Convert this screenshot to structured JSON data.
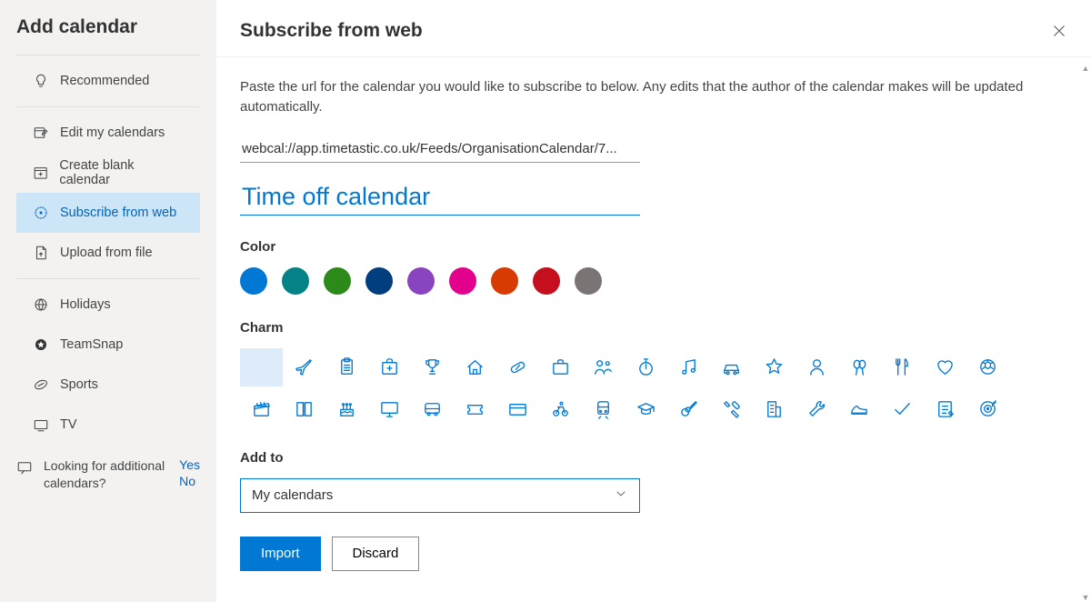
{
  "sidebar": {
    "title": "Add calendar",
    "items": [
      {
        "label": "Recommended",
        "icon": "lightbulb"
      },
      {
        "label": "Edit my calendars",
        "icon": "edit-cal"
      },
      {
        "label": "Create blank calendar",
        "icon": "add-cal"
      },
      {
        "label": "Subscribe from web",
        "icon": "web-cal",
        "active": true
      },
      {
        "label": "Upload from file",
        "icon": "upload"
      },
      {
        "label": "Holidays",
        "icon": "globe"
      },
      {
        "label": "TeamSnap",
        "icon": "teamsnap"
      },
      {
        "label": "Sports",
        "icon": "sports"
      },
      {
        "label": "TV",
        "icon": "tv"
      }
    ],
    "feedback": {
      "text": "Looking for additional calendars?",
      "yes": "Yes",
      "no": "No"
    }
  },
  "main": {
    "title": "Subscribe from web",
    "instructions": "Paste the url for the calendar you would like to subscribe to below. Any edits that the author of the calendar makes will be updated automatically.",
    "url_value": "webcal://app.timetastic.co.uk/Feeds/OrganisationCalendar/7...",
    "name_value": "Time off calendar",
    "labels": {
      "color": "Color",
      "charm": "Charm",
      "addto": "Add to"
    },
    "colors": [
      "#0078d4",
      "#038387",
      "#2b8a1a",
      "#003e7e",
      "#8845bf",
      "#e3008c",
      "#d83b01",
      "#c50f1f",
      "#7a7574"
    ],
    "charms_row1": [
      "none",
      "airplane",
      "clipboard",
      "first-aid",
      "trophy",
      "house",
      "pill",
      "briefcase",
      "people",
      "stopwatch",
      "music-note",
      "car",
      "star",
      "person",
      "balloons",
      "utensils",
      "heart",
      "soccer"
    ],
    "charms_row2": [
      "clapperboard",
      "book",
      "cake",
      "monitor",
      "bus",
      "ticket",
      "credit-card",
      "bicycle",
      "train",
      "graduation",
      "guitar",
      "tools",
      "building",
      "wrench",
      "running-shoe",
      "checkmark",
      "notepad",
      "target"
    ],
    "addto": {
      "selected": "My calendars"
    },
    "buttons": {
      "import": "Import",
      "discard": "Discard"
    }
  }
}
